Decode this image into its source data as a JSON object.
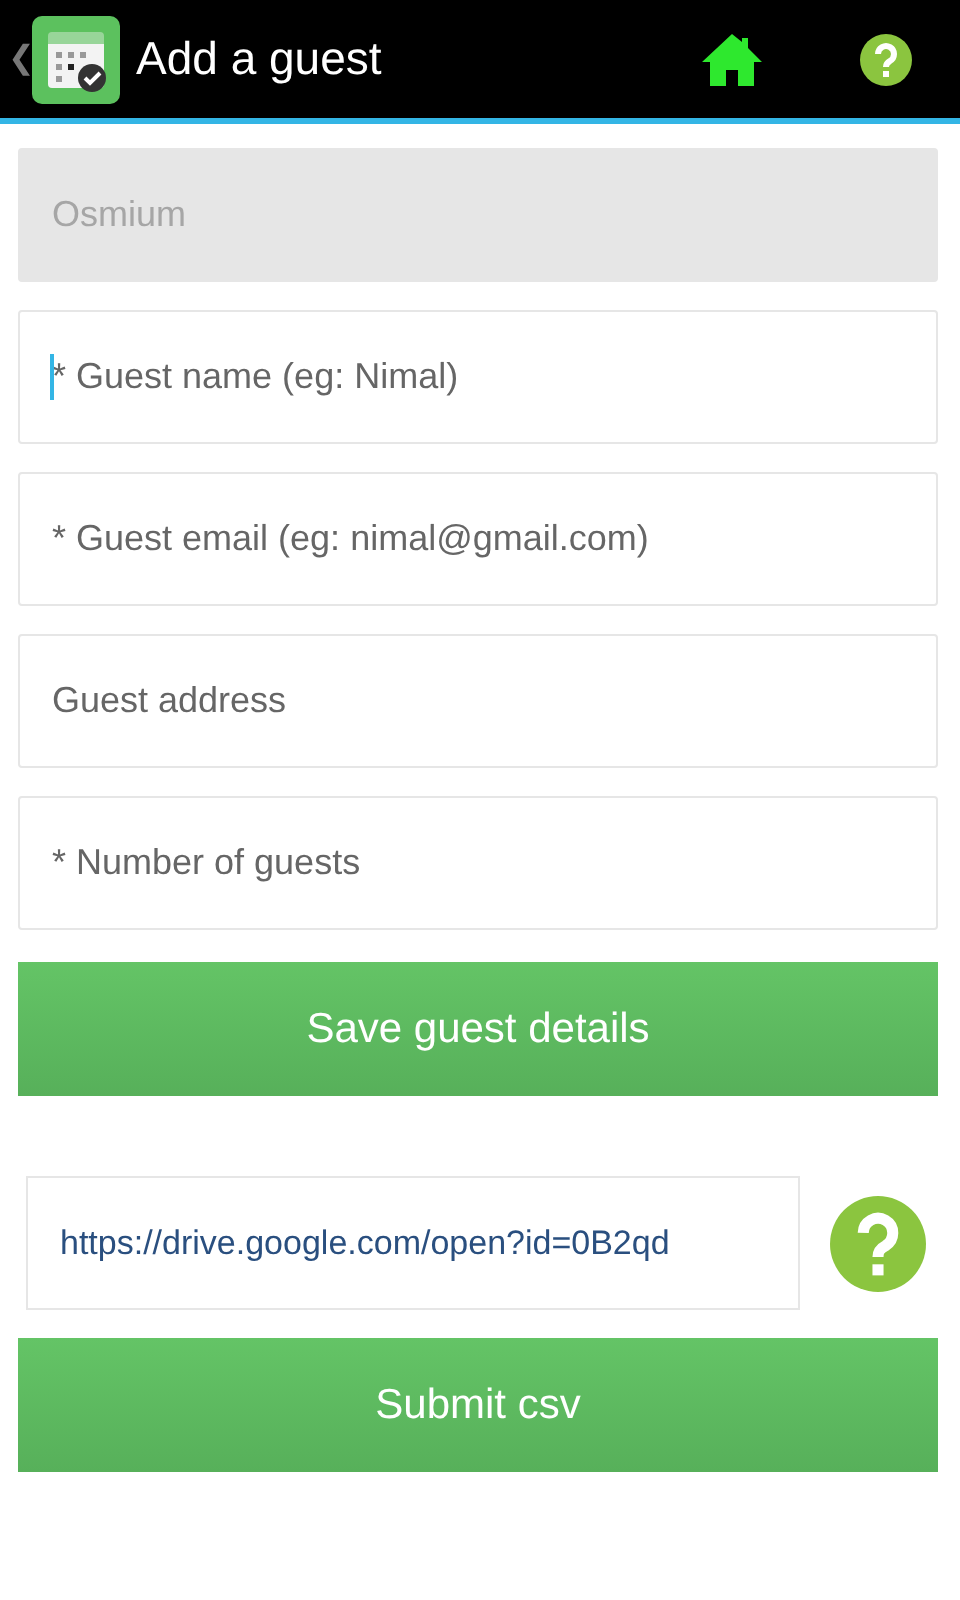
{
  "action_bar": {
    "back": "❮",
    "title": "Add a guest"
  },
  "fields": [
    {
      "value": "Osmium",
      "disabled": true,
      "focused": false
    },
    {
      "placeholder": "* Guest name (eg: Nimal)",
      "disabled": false,
      "focused": true
    },
    {
      "placeholder": "* Guest email (eg: nimal@gmail.com)",
      "disabled": false,
      "focused": false
    },
    {
      "placeholder": "Guest address",
      "disabled": false,
      "focused": false
    },
    {
      "placeholder": "* Number of guests",
      "disabled": false,
      "focused": false
    }
  ],
  "save_button": "Save guest details",
  "csv_field": {
    "value": "https://drive.google.com/open?id=0B2qd"
  },
  "submit_button": "Submit csv"
}
